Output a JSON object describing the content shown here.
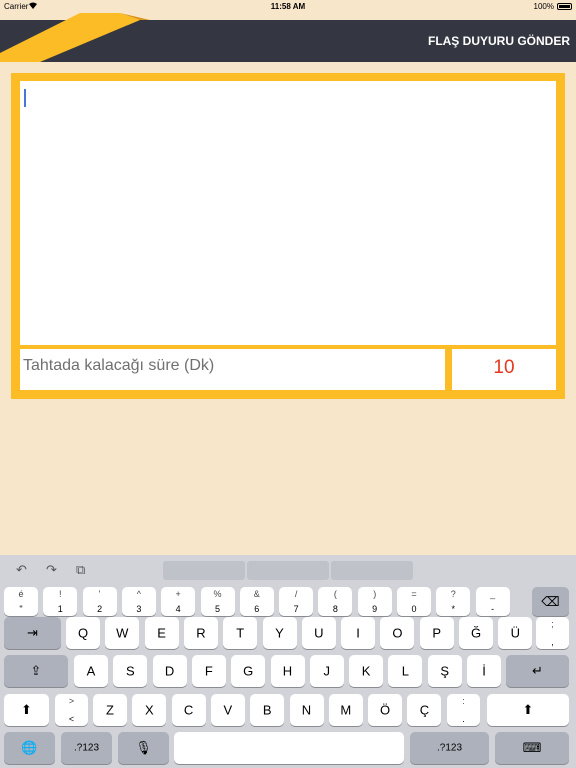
{
  "status_bar": {
    "carrier": "Carrier",
    "time": "11:58 AM",
    "battery": "100%"
  },
  "nav": {
    "title": "FLAŞ DUYURU GÖNDER"
  },
  "form": {
    "message_placeholder": "",
    "duration_label": "Tahtada kalacağı süre (Dk)",
    "duration_value": "10"
  },
  "keyboard": {
    "toolbar": {
      "undo": "↶",
      "redo": "↷",
      "paste": "⧉"
    },
    "row1": [
      {
        "top": "é",
        "bot": "\""
      },
      {
        "top": "!",
        "bot": "1"
      },
      {
        "top": "'",
        "bot": "2"
      },
      {
        "top": "^",
        "bot": "3"
      },
      {
        "top": "+",
        "bot": "4"
      },
      {
        "top": "%",
        "bot": "5"
      },
      {
        "top": "&",
        "bot": "6"
      },
      {
        "top": "/",
        "bot": "7"
      },
      {
        "top": "(",
        "bot": "8"
      },
      {
        "top": ")",
        "bot": "9"
      },
      {
        "top": "=",
        "bot": "0"
      },
      {
        "top": "?",
        "bot": "*"
      },
      {
        "top": "_",
        "bot": "-"
      }
    ],
    "row2": [
      "Q",
      "W",
      "E",
      "R",
      "T",
      "Y",
      "U",
      "I",
      "O",
      "P",
      "Ğ",
      "Ü"
    ],
    "row2_last": {
      "top": ";",
      "bot": ","
    },
    "row3": [
      "A",
      "S",
      "D",
      "F",
      "G",
      "H",
      "J",
      "K",
      "L",
      "Ş",
      "İ"
    ],
    "row4_first": {
      "top": ">",
      "bot": "<"
    },
    "row4": [
      "Z",
      "X",
      "C",
      "V",
      "B",
      "N",
      "M",
      "Ö",
      "Ç"
    ],
    "row4_last": {
      "top": ":",
      "bot": "."
    },
    "numbers_label": ".?123",
    "icons": {
      "delete": "⌫",
      "tab": "⇥",
      "caps": "⇪",
      "return": "↵",
      "shift": "⬆",
      "globe": "🌐",
      "mic": "🎙",
      "hide": "⌨"
    }
  }
}
